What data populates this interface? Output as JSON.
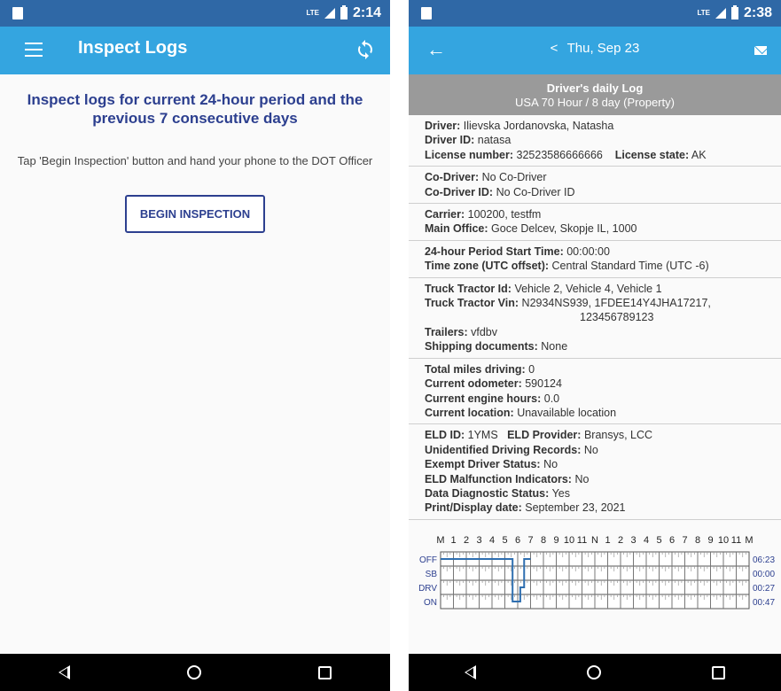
{
  "left": {
    "status": {
      "time": "2:14",
      "network": "LTE"
    },
    "appbar": {
      "title": "Inspect Logs"
    },
    "heading": "Inspect logs for current 24-hour period and the previous 7 consecutive days",
    "instructions": "Tap 'Begin Inspection' button and hand your phone to the DOT Officer",
    "begin_button": "BEGIN INSPECTION"
  },
  "right": {
    "status": {
      "time": "2:38",
      "network": "LTE"
    },
    "appbar": {
      "date": "Thu, Sep 23",
      "prev": "<"
    },
    "header": {
      "title": "Driver's daily Log",
      "subtitle": "USA 70 Hour / 8 day (Property)"
    },
    "driver": {
      "driver_label": "Driver:",
      "driver": "Ilievska Jordanovska, Natasha",
      "id_label": "Driver ID:",
      "id": "natasa",
      "license_label": "License number:",
      "license": "32523586666666",
      "state_label": "License state:",
      "state": "AK"
    },
    "codriver": {
      "codriver_label": "Co-Driver:",
      "codriver": "No Co-Driver",
      "codriver_id_label": "Co-Driver ID:",
      "codriver_id": "No Co-Driver ID"
    },
    "carrier": {
      "carrier_label": "Carrier:",
      "carrier": "100200, testfm",
      "office_label": "Main Office:",
      "office": "Goce Delcev, Skopje IL, 1000"
    },
    "period": {
      "start_label": "24-hour Period Start Time:",
      "start": "00:00:00",
      "tz_label": "Time zone (UTC offset):",
      "tz": "Central Standard Time (UTC -6)"
    },
    "truck": {
      "tractor_label": "Truck Tractor Id:",
      "tractor": "Vehicle 2, Vehicle 4, Vehicle 1",
      "vin_label": "Truck Tractor Vin:",
      "vin_line1": "N2934NS939, 1FDEE14Y4JHA17217,",
      "vin_line2": "123456789123",
      "trailers_label": "Trailers:",
      "trailers": "vfdbv",
      "shipping_label": "Shipping documents:",
      "shipping": "None"
    },
    "miles": {
      "miles_label": "Total miles driving:",
      "miles": "0",
      "odo_label": "Current odometer:",
      "odo": "590124",
      "hours_label": "Current engine hours:",
      "hours": "0.0",
      "loc_label": "Current location:",
      "loc": "Unavailable location"
    },
    "eld": {
      "eld_label": "ELD ID:",
      "eld": "1YMS",
      "provider_label": "ELD Provider:",
      "provider": "Bransys, LCC",
      "unid_label": "Unidentified Driving Records:",
      "unid": "No",
      "exempt_label": "Exempt Driver Status:",
      "exempt": "No",
      "malf_label": "ELD Malfunction Indicators:",
      "malf": "No",
      "diag_label": "Data Diagnostic Status:",
      "diag": "Yes",
      "print_label": "Print/Display date:",
      "print": "September 23, 2021"
    },
    "chart_data": {
      "type": "line",
      "hour_labels": [
        "M",
        "1",
        "2",
        "3",
        "4",
        "5",
        "6",
        "7",
        "8",
        "9",
        "10",
        "11",
        "N",
        "1",
        "2",
        "3",
        "4",
        "5",
        "6",
        "7",
        "8",
        "9",
        "10",
        "11",
        "M"
      ],
      "statuses": [
        "OFF",
        "SB",
        "DRV",
        "ON"
      ],
      "totals": [
        "06:23",
        "00:00",
        "00:27",
        "00:47"
      ],
      "segments": [
        {
          "status": "OFF",
          "start": 0,
          "end": 5.6
        },
        {
          "status": "ON",
          "start": 5.6,
          "end": 6.2
        },
        {
          "status": "DRV",
          "start": 6.2,
          "end": 6.5
        },
        {
          "status": "OFF",
          "start": 6.5,
          "end": 7
        }
      ],
      "line_color": "#2f6fb0"
    }
  },
  "colors": {
    "statusbar": "#2f68a6",
    "appbar": "#34a5e0",
    "heading": "#2c3f8f"
  }
}
